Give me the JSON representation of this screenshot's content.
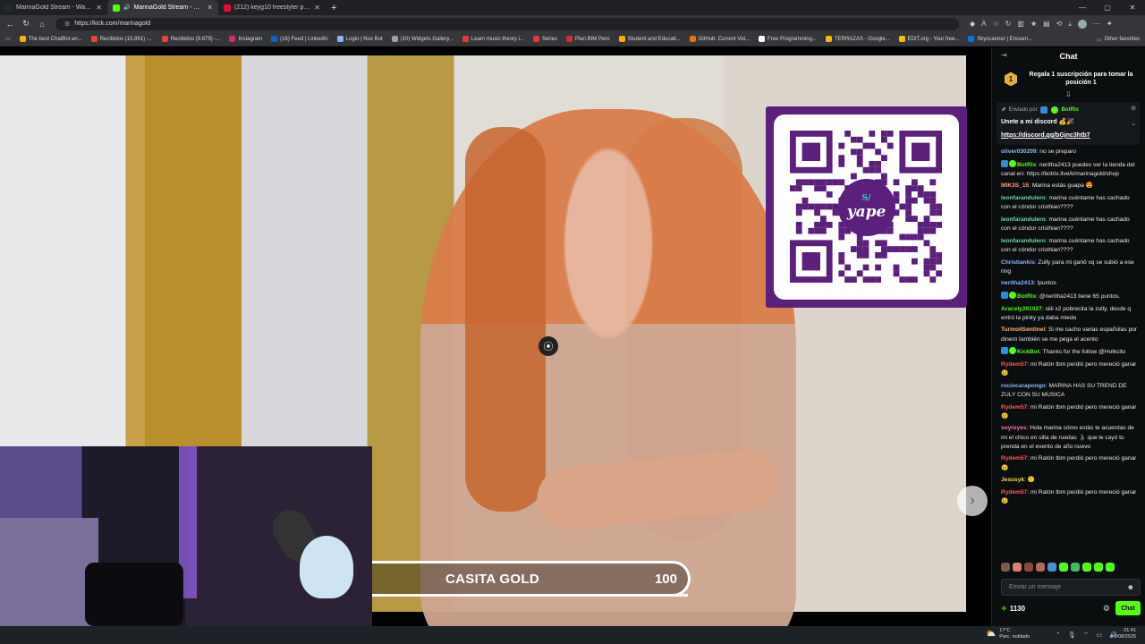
{
  "browser": {
    "tabs": [
      {
        "title": "MarinaGold Stream - Watch Live",
        "favicon_color": "#1f2a33",
        "active": false
      },
      {
        "title": "MarinaGold Stream - Watch",
        "favicon_color": "#53fc18",
        "active": true,
        "audio": true
      },
      {
        "title": "(212) keyg10 freestyler peru - You",
        "favicon_color": "#ff0033",
        "active": false
      }
    ],
    "new_tab_icon": "plus-icon",
    "url": "https://kick.com/marinagold",
    "bookmarks": [
      {
        "label": "The best ChatBot an...",
        "color": "#f4b400"
      },
      {
        "label": "Recibidos (15.891) -...",
        "color": "#ea4335"
      },
      {
        "label": "Recibidos (9.879) -...",
        "color": "#ea4335"
      },
      {
        "label": "Instagram",
        "color": "#d62976"
      },
      {
        "label": "(16) Feed | LinkedIn",
        "color": "#0a66c2"
      },
      {
        "label": "Login | Nox Bot",
        "color": "#8ab4f8"
      },
      {
        "label": "(10) Widgets Gallery...",
        "color": "#9aa0a6"
      },
      {
        "label": "Learn music theory i...",
        "color": "#e53935"
      },
      {
        "label": "Series",
        "color": "#e53935"
      },
      {
        "label": "Plan BIM Perú",
        "color": "#d32f2f"
      },
      {
        "label": "Student and Educati...",
        "color": "#f9ab00"
      },
      {
        "label": "GitHub: Current Vid...",
        "color": "#e8710a"
      },
      {
        "label": "Free Programming...",
        "color": "#ffffff"
      },
      {
        "label": "TERRAZAS - Google...",
        "color": "#fbbc04"
      },
      {
        "label": "EDIT.org - Your free...",
        "color": "#fbbc04"
      },
      {
        "label": "Skyscanner | Encuen...",
        "color": "#0770e3"
      }
    ],
    "other_favorites": "Other favorites"
  },
  "stream": {
    "goal_label": "CASITA GOLD",
    "goal_value": "100",
    "goal_progress": 1.0,
    "qr_logo_text": "yape",
    "qr_logo_sub": "S/"
  },
  "chat": {
    "title": "Chat",
    "gift_rank": "1",
    "gift_text": "Regala 1 suscripción para tomar la posición 1",
    "pinned": {
      "sent_by_label": "Enviado por",
      "sender": "BotRix",
      "message": "Unete a mi discord 💰🎉",
      "link": "https://discord.gg/bGjnc3htb7"
    },
    "messages": [
      {
        "user": "oliver030209",
        "color": "#8fb9ff",
        "text": "no se preparo"
      },
      {
        "user": "BotRix",
        "color": "#53fc18",
        "bot": true,
        "text": "neritha2413 puedes ver la tienda del canal en: https://botrix.live/k/marinagold/shop"
      },
      {
        "user": "MIK3S_15",
        "color": "#ff9a7a",
        "text": "Marina estás guapa 😍"
      },
      {
        "user": "leonfarandulero",
        "color": "#6fd6a4",
        "text": "marina cuéntame has cachado con el cóndor cristhian????"
      },
      {
        "user": "leonfarandulero",
        "color": "#6fd6a4",
        "text": "marina cuéntame has cachado con el cóndor cristhian????"
      },
      {
        "user": "leonfarandulero",
        "color": "#6fd6a4",
        "text": "marina cuéntame has cachado con el cóndor cristhian????"
      },
      {
        "user": "Christiankis",
        "color": "#8ab4ff",
        "text": "Zully para mi ganó xq se subió a ese ring"
      },
      {
        "user": "neritha2413",
        "color": "#8ab4ff",
        "text": "!puntos"
      },
      {
        "user": "BotRix",
        "color": "#53fc18",
        "bot": true,
        "text": "@neritha2413 tiene 65 puntos."
      },
      {
        "user": "Aracely201027",
        "color": "#53fc18",
        "text": "siiii x2 pobrecita la zully, desde q entró la pinky ya daba miedo"
      },
      {
        "user": "TurmoilSentinel",
        "color": "#ffb07a",
        "text": "Si me cacho varias españolas por dinero también se me pega el acento"
      },
      {
        "user": "KickBot",
        "color": "#53fc18",
        "bot": true,
        "text": "Thanks for the follow @Holkcito"
      },
      {
        "user": "Rydem57",
        "color": "#ff5a5a",
        "text": "mi Ratón tbm perdió pero mereció ganar 😢"
      },
      {
        "user": "rociocarapongo",
        "color": "#8ab4ff",
        "text": "MARINA HAS SU TREND DE ZULY CON SU MUSICA"
      },
      {
        "user": "Rydem57",
        "color": "#ff5a5a",
        "text": "mi Ratón tbm perdió pero mereció ganar 😢"
      },
      {
        "user": "soyreyes",
        "color": "#ff6fa8",
        "text": "Hola marina cómo estás te acuerdas de mi el chico en silla de ruedas 👨‍🦽 que le cayó tu prenda en el evento de año nuevo"
      },
      {
        "user": "Rydem57",
        "color": "#ff5a5a",
        "text": "mi Ratón tbm perdió pero mereció ganar 😢"
      },
      {
        "user": "Jesusyk",
        "color": "#ffd54f",
        "text": "🙂"
      },
      {
        "user": "Rydem57",
        "color": "#ff5a5a",
        "text": "mi Ratón tbm perdió pero mereció ganar 😢"
      }
    ],
    "emotes": [
      "#7a5b4a",
      "#d8836c",
      "#8c4a3a",
      "#b46a5a",
      "#4a90d9",
      "#53fc18",
      "#3fbf5f",
      "#53fc18",
      "#53fc18",
      "#53fc18"
    ],
    "input_placeholder": "Enviar un mensaje",
    "points": "1130",
    "send_label": "Chat"
  },
  "taskbar": {
    "temperature": "17°C",
    "weather": "Parc. nublado",
    "time": "01:41",
    "date": "3/08/2025"
  }
}
